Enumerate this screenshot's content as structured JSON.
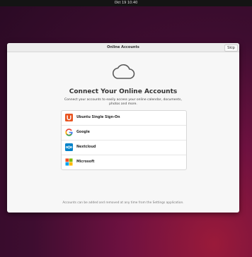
{
  "topbar": {
    "clock": "Okt 19  10:40"
  },
  "window": {
    "title": "Online Accounts",
    "skip_label": "Skip"
  },
  "main": {
    "cloud_icon": "cloud-icon",
    "heading": "Connect Your Online Accounts",
    "subtitle": "Connect your accounts to easily access your online calendar, documents, photos and more.",
    "accounts": [
      {
        "label": "Ubuntu Single Sign-On",
        "icon": "ubuntu-sso-icon"
      },
      {
        "label": "Google",
        "icon": "google-icon"
      },
      {
        "label": "Nextcloud",
        "icon": "nextcloud-icon"
      },
      {
        "label": "Microsoft",
        "icon": "microsoft-icon"
      }
    ],
    "footer": "Accounts can be added and removed at any time from the Settings application."
  },
  "colors": {
    "ubuntu_orange": "#e95420",
    "google_blue": "#4285f4",
    "google_red": "#ea4335",
    "google_yellow": "#fbbc05",
    "google_green": "#34a853",
    "nextcloud_blue": "#0082c9",
    "ms_red": "#f25022",
    "ms_green": "#7fba00",
    "ms_blue": "#00a4ef",
    "ms_yellow": "#ffb900"
  }
}
